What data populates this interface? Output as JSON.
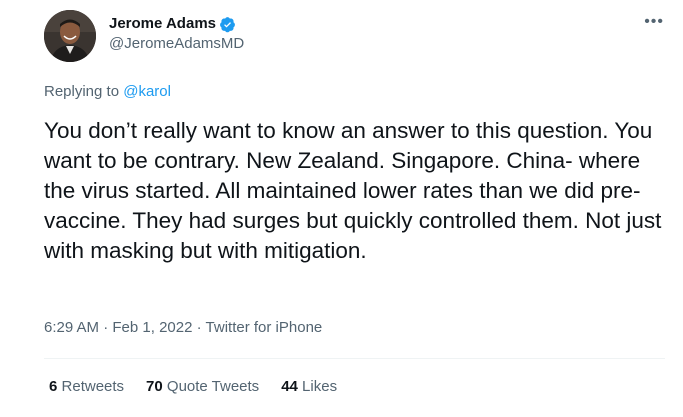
{
  "author": {
    "display_name": "Jerome Adams",
    "handle": "@JeromeAdamsMD",
    "verified_icon": "verified-badge-icon",
    "avatar": "profile-photo"
  },
  "more_label": "•••",
  "reply": {
    "prefix": "Replying to",
    "mention": "@karol"
  },
  "text": "You don’t really want to know an answer to this question. You want to be contrary. New Zealand. Singapore. China- where the virus started. All maintained lower rates than we did pre-vaccine. They had surges but quickly controlled them. Not just with masking but with mitigation.",
  "meta": {
    "time": "6:29 AM",
    "sep1": "·",
    "date": "Feb 1, 2022",
    "sep2": "·",
    "source": "Twitter for iPhone"
  },
  "stats": {
    "retweets_count": "6",
    "retweets_label": "Retweets",
    "quotes_count": "70",
    "quotes_label": "Quote Tweets",
    "likes_count": "44",
    "likes_label": "Likes"
  },
  "colors": {
    "link": "#1d9bf0",
    "muted": "#536471",
    "text": "#0f1419",
    "divider": "#eff3f4"
  }
}
